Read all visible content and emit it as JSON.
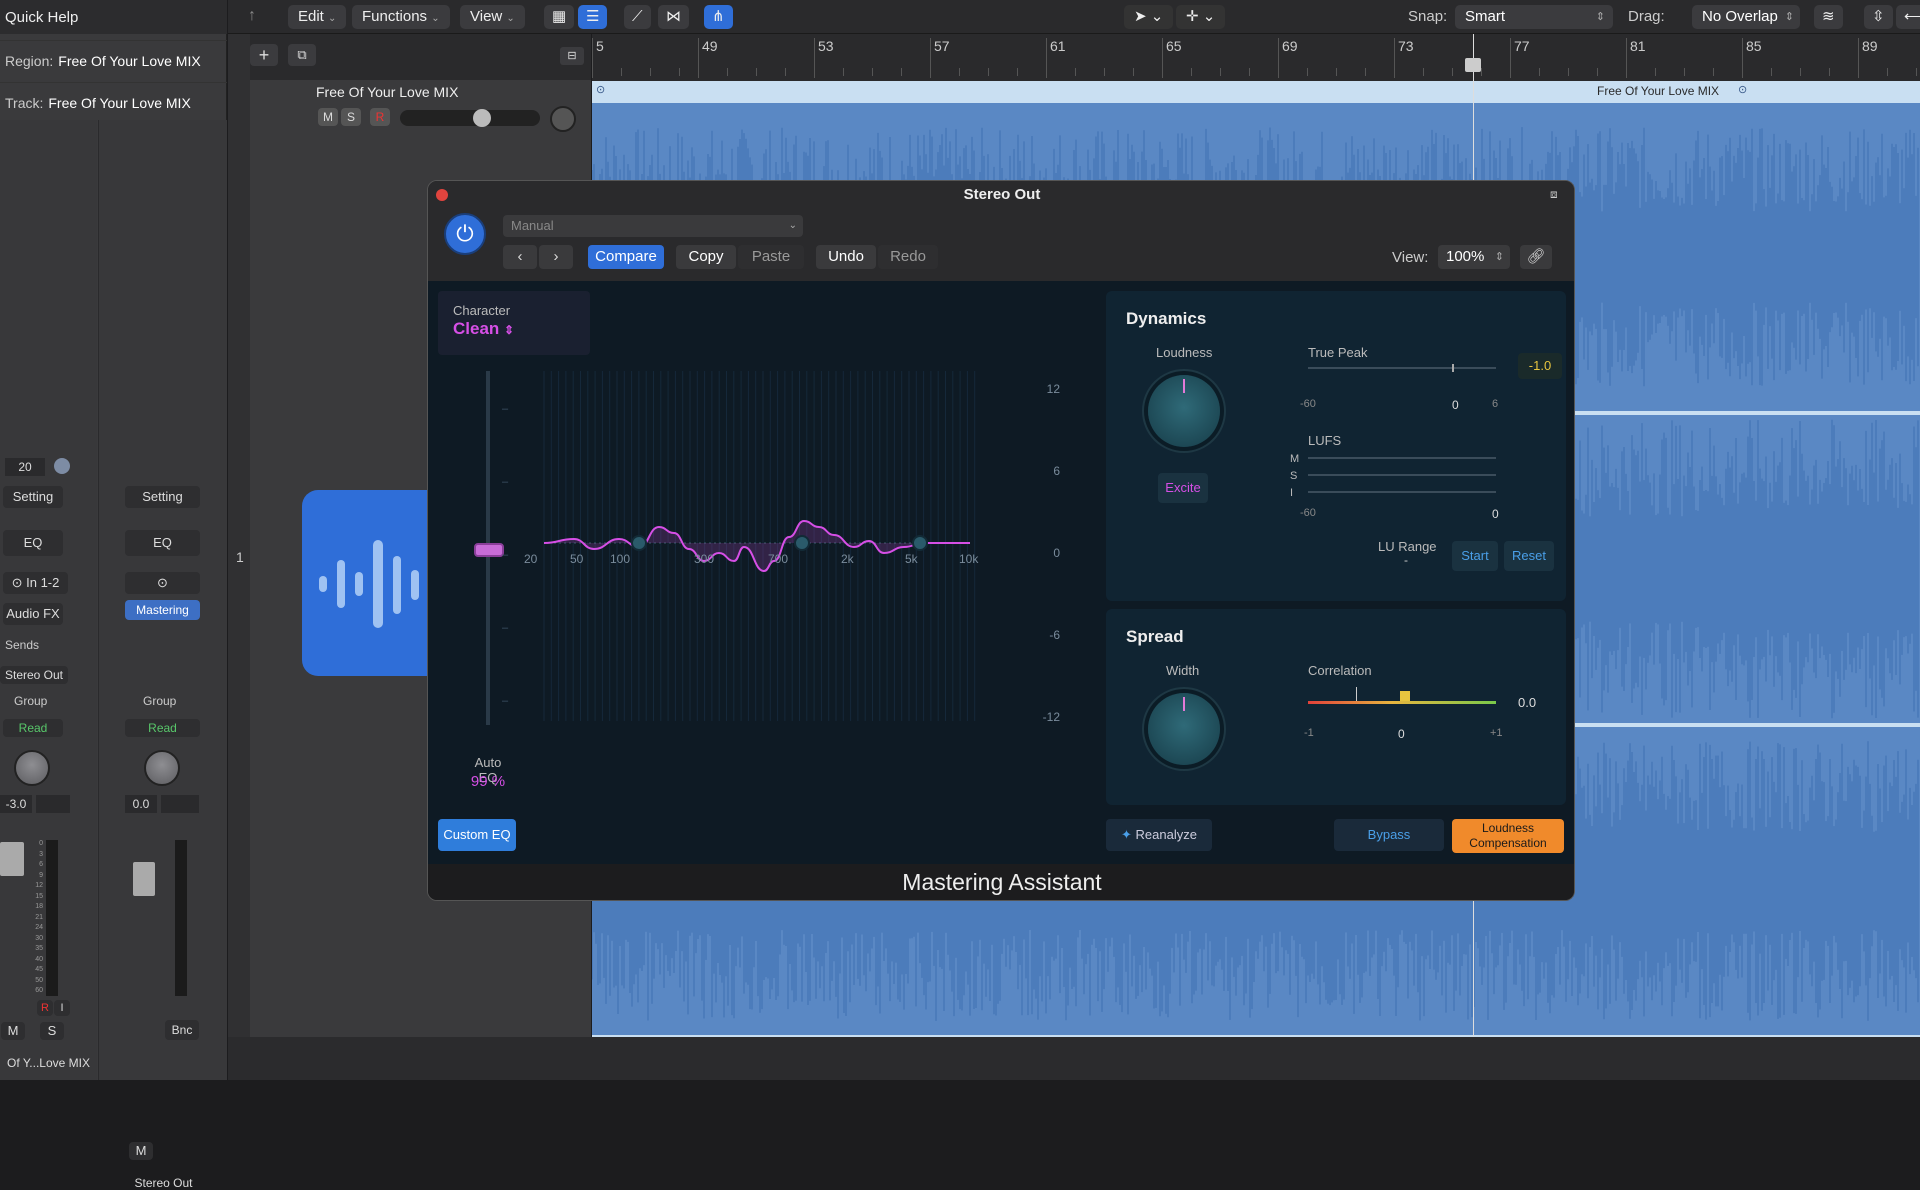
{
  "inspector": {
    "title": "Quick Help",
    "region_label": "Region:",
    "region_value": "Free Of Your Love MIX",
    "track_label": "Track:",
    "track_value": "Free Of Your Love MIX",
    "strip1": {
      "value_20": "20",
      "setting": "Setting",
      "eq": "EQ",
      "input": "In 1-2",
      "audio_fx": "Audio FX",
      "sends": "Sends",
      "output": "Stereo Out",
      "group": "Group",
      "automation": "Read",
      "volume": "-3.0",
      "record": "R",
      "input_mon": "I",
      "mute": "M",
      "solo": "S",
      "name": "Of Y...Love MIX"
    },
    "strip2": {
      "setting": "Setting",
      "eq": "EQ",
      "plugin": "Mastering",
      "group": "Group",
      "automation": "Read",
      "volume": "0.0",
      "bounce": "Bnc",
      "mute": "M",
      "name": "Stereo Out"
    },
    "meter_scale": [
      "0",
      "3",
      "6",
      "9",
      "12",
      "15",
      "18",
      "21",
      "24",
      "30",
      "35",
      "40",
      "45",
      "50",
      "60"
    ]
  },
  "toolbar": {
    "menus": [
      "Edit",
      "Functions",
      "View"
    ],
    "snap_label": "Snap:",
    "snap_value": "Smart",
    "drag_label": "Drag:",
    "drag_value": "No Overlap"
  },
  "track": {
    "number": "1",
    "name": "Free Of Your Love MIX",
    "mute": "M",
    "solo": "S",
    "record": "R",
    "volume_fraction": 0.6
  },
  "ruler": {
    "bars": [
      "5",
      "49",
      "53",
      "57",
      "61",
      "65",
      "69",
      "73",
      "77",
      "81",
      "85",
      "89"
    ]
  },
  "region": {
    "name": "Free Of Your Love MIX"
  },
  "plugin": {
    "window_title": "Stereo Out",
    "preset": "Manual",
    "buttons": {
      "compare": "Compare",
      "copy": "Copy",
      "paste": "Paste",
      "undo": "Undo",
      "redo": "Redo"
    },
    "view_label": "View:",
    "view_value": "100%",
    "character_label": "Character",
    "character_value": "Clean",
    "auto_eq_label": "Auto EQ",
    "auto_eq_value": "99 %",
    "eq_freq_labels": [
      "20",
      "50",
      "100",
      "300",
      "700",
      "2k",
      "5k",
      "10k"
    ],
    "eq_db_labels": [
      "12",
      "6",
      "0",
      "-6",
      "-12"
    ],
    "custom_eq": "Custom EQ",
    "dynamics": {
      "title": "Dynamics",
      "loudness_label": "Loudness",
      "excite": "Excite",
      "true_peak_label": "True Peak",
      "true_peak_value": "-1.0",
      "tp_scale": [
        "-60",
        "0",
        "6"
      ],
      "lufs_label": "LUFS",
      "lufs_rows": [
        "M",
        "S",
        "I"
      ],
      "lufs_scale": [
        "-60",
        "0"
      ],
      "lu_range_label": "LU Range",
      "lu_range_value": "-",
      "start": "Start",
      "reset": "Reset"
    },
    "spread": {
      "title": "Spread",
      "width_label": "Width",
      "correlation_label": "Correlation",
      "correlation_value": "0.0",
      "corr_scale": [
        "-1",
        "0",
        "+1"
      ]
    },
    "reanalyze": "Reanalyze",
    "bypass": "Bypass",
    "loudness_comp": "Loudness Compensation",
    "plugin_name": "Mastering Assistant"
  },
  "colors": {
    "accent_blue": "#2f7ddb",
    "pink": "#d64fe6",
    "orange": "#f08a2b",
    "waveform": "#3d6fb2"
  }
}
